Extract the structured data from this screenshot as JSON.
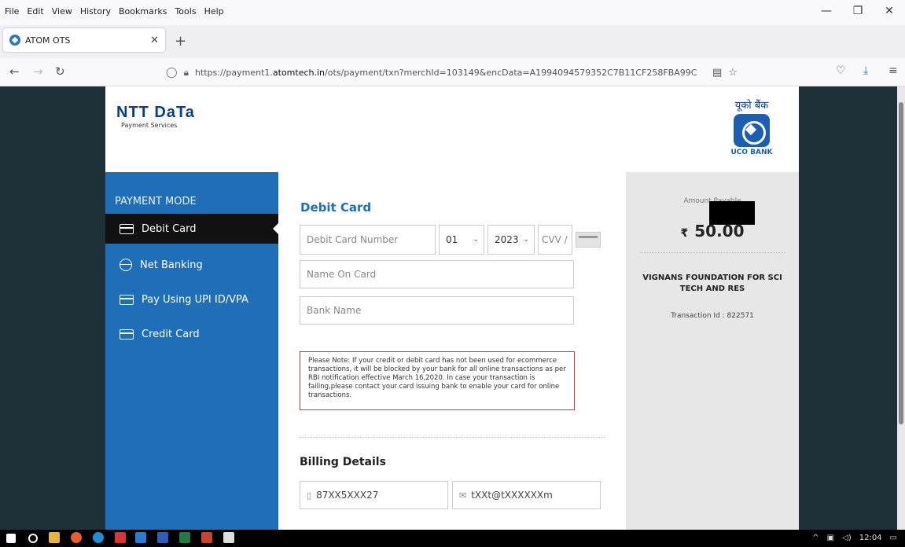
{
  "browser": {
    "menu": [
      "File",
      "Edit",
      "View",
      "History",
      "Bookmarks",
      "Tools",
      "Help"
    ],
    "tab_title": "ATOM OTS",
    "url_prefix": "https://payment1.",
    "url_domain": "atomtech.in",
    "url_rest": "/ots/payment/txn?merchId=103149&encData=A1994094579352C7B11CF258FBA99C"
  },
  "header": {
    "brand_name": "NTT DaTa",
    "brand_sub": "Payment Services",
    "bank_hindi": "यूको बैंक",
    "bank_name": "UCO BANK"
  },
  "sidebar": {
    "title": "PAYMENT MODE",
    "items": [
      {
        "label": "Debit Card",
        "icon": "card-icon"
      },
      {
        "label": "Net Banking",
        "icon": "globe-icon"
      },
      {
        "label": "Pay Using UPI ID/VPA",
        "icon": "card-icon"
      },
      {
        "label": "Credit Card",
        "icon": "card-icon"
      }
    ]
  },
  "form": {
    "heading": "Debit Card",
    "card_number_placeholder": "Debit Card Number",
    "month_value": "01",
    "year_value": "2023",
    "cvv_placeholder": "CVV /",
    "name_placeholder": "Name On Card",
    "bank_placeholder": "Bank Name",
    "note": "Please Note: If your credit or debit card has not been used for ecommerce transactions, it will be blocked by your bank for all online transactions as per RBI notification effective March 16,2020. In case your transaction is failing,please contact your card issuing bank to enable your card for online transactions.",
    "billing_heading": "Billing Details",
    "phone_value": "87XX5XXX27",
    "email_value": "tXXt@tXXXXXXm"
  },
  "summary": {
    "amount_label": "Amount Payable",
    "currency": "₹",
    "amount": "50.00",
    "merchant": "VIGNANS FOUNDATION FOR SCI TECH AND RES",
    "transaction": "Transaction Id : 822571"
  },
  "taskbar": {
    "time": "12:04"
  }
}
